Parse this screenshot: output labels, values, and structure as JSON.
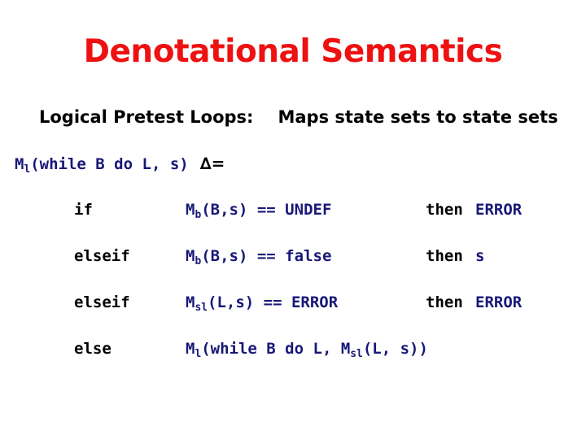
{
  "slide": {
    "title": "Denotational Semantics",
    "title_color": "#EE1111",
    "background_color": "#FFFFFF",
    "code_color": "#181878",
    "text_color": "#000000"
  },
  "subtitle": {
    "label": "Logical Pretest Loops:",
    "description": "Maps state sets to state sets"
  },
  "definition": {
    "function_name": "M",
    "function_subscript": "l",
    "signature_body": "(while B do L, s)",
    "defined_as_symbol": "∆=",
    "full_text": "Ml(while B do L, s) ∆="
  },
  "clauses": [
    {
      "keyword": "if",
      "cond_fn": "M",
      "cond_sub": "b",
      "cond_body": "(B,s) == UNDEF",
      "then_keyword": "then",
      "result": "ERROR",
      "result_sub": "",
      "result_tail": ""
    },
    {
      "keyword": "elseif",
      "cond_fn": "M",
      "cond_sub": "b",
      "cond_body": "(B,s) == false",
      "then_keyword": "then",
      "result": "s",
      "result_sub": "",
      "result_tail": ""
    },
    {
      "keyword": "elseif",
      "cond_fn": "M",
      "cond_sub": "sl",
      "cond_body": "(L,s) == ERROR",
      "then_keyword": "then",
      "result": "ERROR",
      "result_sub": "",
      "result_tail": ""
    },
    {
      "keyword": "else",
      "cond_fn": "M",
      "cond_sub": "l",
      "cond_body": "(while B do L, ",
      "cond_fn2": "M",
      "cond_sub2": "sl",
      "cond_body2": "(L, s))",
      "then_keyword": "",
      "result": "",
      "result_sub": "",
      "result_tail": ""
    }
  ]
}
